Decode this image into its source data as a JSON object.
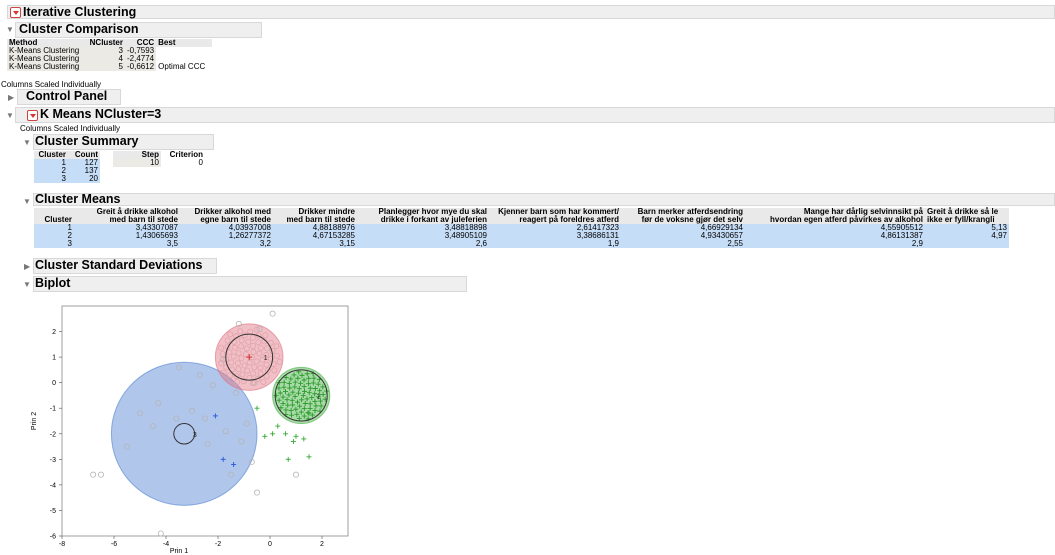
{
  "report": {
    "title": "Iterative Clustering"
  },
  "comparison": {
    "title": "Cluster Comparison",
    "headers": [
      "Method",
      "NCluster",
      "CCC",
      "Best"
    ],
    "rows": [
      [
        "K-Means Clustering",
        "3",
        "-0,7593",
        ""
      ],
      [
        "K-Means Clustering",
        "4",
        "-2,4774",
        ""
      ],
      [
        "K-Means Clustering",
        "5",
        "-0,6612",
        "Optimal CCC"
      ]
    ],
    "note": "Columns Scaled Individually"
  },
  "control_panel": {
    "title": "Control Panel"
  },
  "kmeans": {
    "title": "K Means NCluster=3",
    "note": "Columns Scaled Individually"
  },
  "summary": {
    "title": "Cluster Summary",
    "headers": [
      "Cluster",
      "Count"
    ],
    "rows": [
      [
        "1",
        "127"
      ],
      [
        "2",
        "137"
      ],
      [
        "3",
        "20"
      ]
    ],
    "step_headers": [
      "Step",
      "Criterion"
    ],
    "step_row": [
      "10",
      "0"
    ]
  },
  "means": {
    "title": "Cluster Means",
    "col0": "Cluster",
    "columns": [
      [
        "Greit å drikke alkohol",
        "med barn til stede"
      ],
      [
        "Drikker alkohol med",
        "egne barn til stede"
      ],
      [
        "Drikker mindre",
        "med barn til stede"
      ],
      [
        "Planlegger hvor mye du skal",
        "drikke i forkant av juleferien"
      ],
      [
        "Kjenner barn som har kommert/",
        "reagert på foreldres atferd"
      ],
      [
        "Barn merker atferdsendring",
        "før de voksne gjør det selv"
      ],
      [
        "Mange har dårlig selvinnsikt på",
        "hvordan egen atferd påvirkes av alkohol"
      ],
      [
        "Greit å drikke så le",
        "ikke er fyll/krangli"
      ]
    ],
    "rows": [
      [
        "1",
        "3,43307087",
        "4,03937008",
        "4,88188976",
        "3,48818898",
        "2,61417323",
        "4,66929134",
        "4,55905512",
        "5,13"
      ],
      [
        "2",
        "1,43065693",
        "1,26277372",
        "4,67153285",
        "3,48905109",
        "3,38686131",
        "4,93430657",
        "4,86131387",
        "4,97"
      ],
      [
        "3",
        "3,5",
        "3,2",
        "3,15",
        "2,6",
        "1,9",
        "2,55",
        "2,9",
        ""
      ]
    ]
  },
  "std": {
    "title": "Cluster Standard Deviations"
  },
  "biplot": {
    "title": "Biplot",
    "colors": {
      "c1": "#e07080",
      "c2": "#40b040",
      "c3": "#5080d0",
      "gray": "#b0b0b0"
    }
  },
  "chart_data": {
    "type": "scatter",
    "xlabel": "Prin 1",
    "ylabel": "Prin 2",
    "xlim": [
      -8,
      3
    ],
    "ylim": [
      -6,
      3
    ],
    "xticks": [
      -8,
      -6,
      -4,
      -2,
      0,
      2
    ],
    "yticks": [
      -6,
      -5,
      -4,
      -3,
      -2,
      -1,
      0,
      1,
      2
    ],
    "clusters": [
      {
        "label": "1",
        "center": [
          -0.8,
          1.0
        ],
        "radius": 1.3,
        "circle_r": 0.9,
        "color": "#e07080"
      },
      {
        "label": "2",
        "center": [
          1.2,
          -0.5
        ],
        "radius": 1.1,
        "circle_r": 1.0,
        "color": "#40b040"
      },
      {
        "label": "3",
        "center": [
          -3.3,
          -2.0
        ],
        "radius": 2.8,
        "circle_r": 0.4,
        "color": "#5080d0"
      }
    ],
    "blue_points": [
      [
        -2.1,
        -1.3
      ],
      [
        -1.8,
        -3.0
      ],
      [
        -1.4,
        -3.2
      ]
    ],
    "green_points": [
      [
        0.3,
        -1.7
      ],
      [
        0.6,
        -2.0
      ],
      [
        0.9,
        -2.3
      ],
      [
        1.3,
        -2.2
      ],
      [
        1.5,
        -1.2
      ],
      [
        -0.2,
        -2.1
      ],
      [
        0.7,
        -3.0
      ],
      [
        1.5,
        -2.9
      ],
      [
        0.1,
        -2.0
      ],
      [
        1.0,
        -2.1
      ],
      [
        -0.5,
        -1.0
      ]
    ],
    "gray_points": [
      [
        -6.8,
        -3.6
      ],
      [
        -6.5,
        -3.6
      ],
      [
        -4.2,
        -5.9
      ],
      [
        -0.5,
        -4.3
      ],
      [
        1.0,
        -3.6
      ],
      [
        0.1,
        2.7
      ],
      [
        -2.5,
        -1.4
      ],
      [
        -5.5,
        -2.5
      ],
      [
        -5.0,
        -1.2
      ],
      [
        -4.3,
        -0.8
      ],
      [
        -3.5,
        0.6
      ],
      [
        -1.8,
        0.9
      ],
      [
        -2.2,
        -0.1
      ],
      [
        -0.9,
        -1.6
      ],
      [
        -1.1,
        -2.3
      ],
      [
        -2.4,
        -2.4
      ],
      [
        -1.3,
        -0.4
      ],
      [
        -3.0,
        -1.1
      ],
      [
        -1.7,
        -1.9
      ],
      [
        -0.7,
        -3.1
      ],
      [
        -3.6,
        -1.4
      ],
      [
        -4.5,
        -1.7
      ],
      [
        -2.7,
        0.3
      ],
      [
        -1.2,
        2.3
      ],
      [
        -0.4,
        2.1
      ],
      [
        -0.6,
        0.0
      ],
      [
        -1.5,
        -3.6
      ]
    ]
  }
}
